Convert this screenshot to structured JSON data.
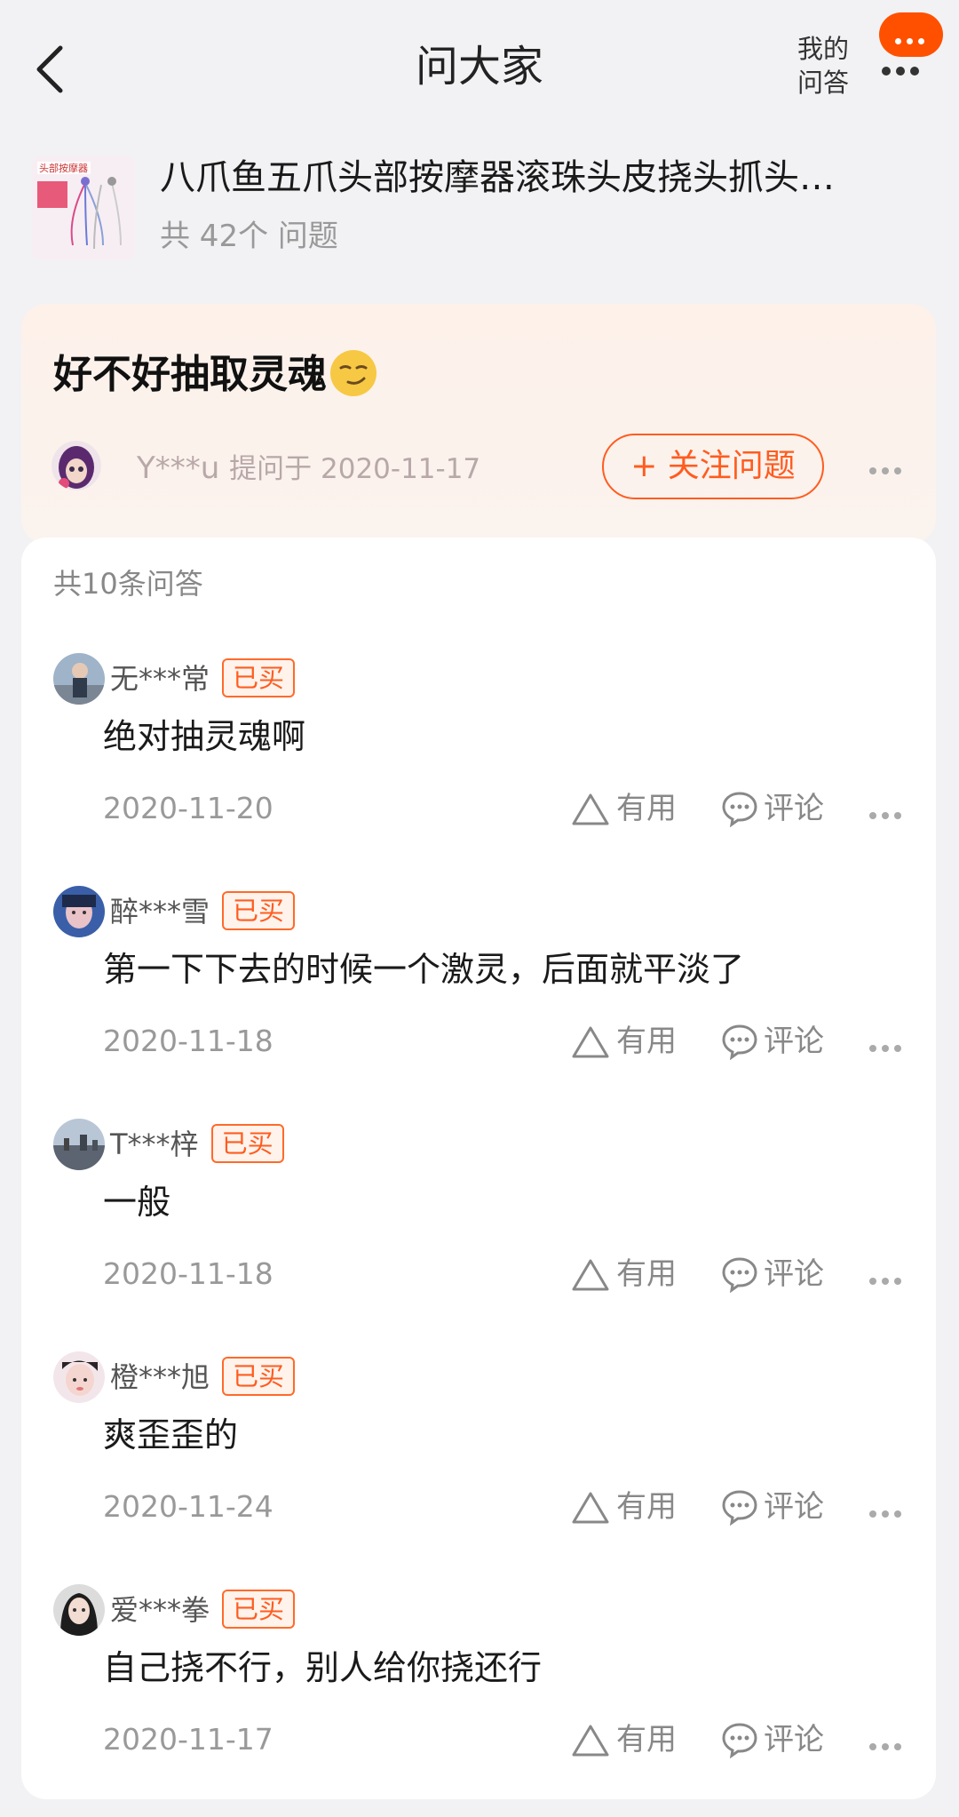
{
  "header": {
    "title": "问大家",
    "my_qa_line1": "我的",
    "my_qa_line2": "问答"
  },
  "product": {
    "name": "八爪鱼五爪头部按摩器滚珠头皮挠头抓头…",
    "question_count": "共 42个 问题",
    "thumb_label": "头部按摩器"
  },
  "question": {
    "text": "好不好抽取灵魂",
    "asker": "Y***u",
    "asked_at": "提问于 2020-11-17",
    "follow_label": "+ 关注问题"
  },
  "answers_header": "共10条问答",
  "answers": [
    {
      "user": "无***常",
      "badge": "已买",
      "text": "绝对抽灵魂啊",
      "date": "2020-11-20",
      "useful": "有用",
      "comment": "评论"
    },
    {
      "user": "醉***雪",
      "badge": "已买",
      "text": "第一下下去的时候一个激灵，后面就平淡了",
      "date": "2020-11-18",
      "useful": "有用",
      "comment": "评论"
    },
    {
      "user": "T***梓",
      "badge": "已买",
      "text": "一般",
      "date": "2020-11-18",
      "useful": "有用",
      "comment": "评论"
    },
    {
      "user": "橙***旭",
      "badge": "已买",
      "text": "爽歪歪的",
      "date": "2020-11-24",
      "useful": "有用",
      "comment": "评论"
    },
    {
      "user": "爱***拳",
      "badge": "已买",
      "text": "自己挠不行，别人给你挠还行",
      "date": "2020-11-17",
      "useful": "有用",
      "comment": "评论"
    }
  ],
  "colors": {
    "accent": "#ff5c1f",
    "chat_bubble": "#ff5000",
    "question_card_bg": "#fdf1ea"
  },
  "icons": [
    "back-arrow-icon",
    "chat-bubble-icon",
    "more-dots-icon",
    "smirk-emoji-icon",
    "triangle-useful-icon",
    "comment-bubble-icon"
  ]
}
